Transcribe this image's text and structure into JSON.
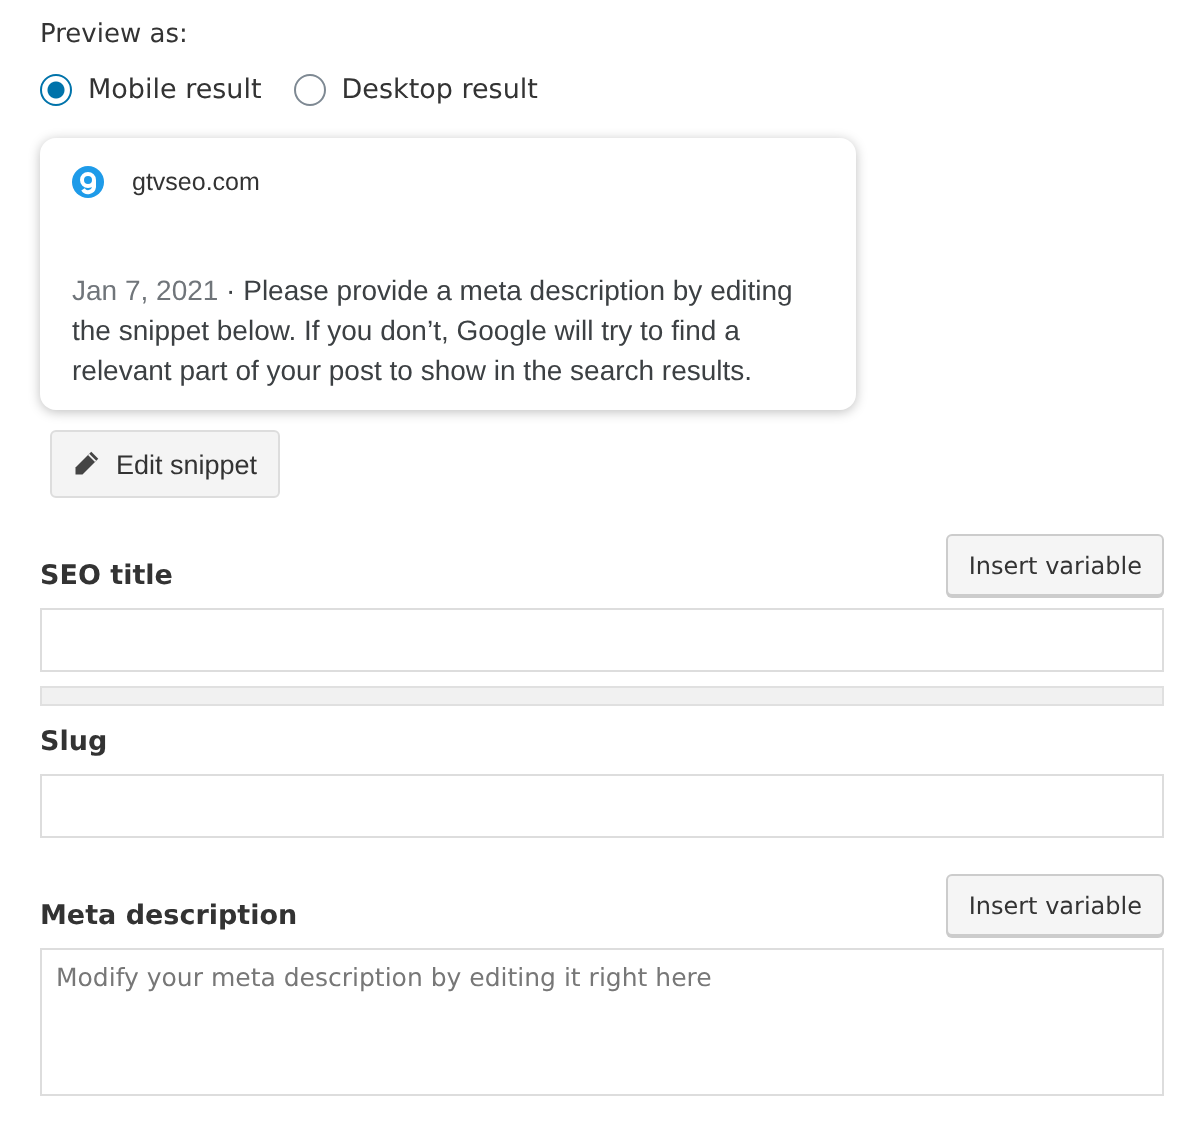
{
  "preview": {
    "label": "Preview as:",
    "options": [
      {
        "label": "Mobile result",
        "selected": true
      },
      {
        "label": "Desktop result",
        "selected": false
      }
    ]
  },
  "snippet": {
    "site": "gtvseo.com",
    "date": "Jan 7, 2021",
    "separator": " · ",
    "description": "Please provide a meta description by editing the snippet below. If you don’t, Google will try to find a relevant part of your post to show in the search results."
  },
  "edit_button": "Edit snippet",
  "fields": [
    {
      "kind": "input",
      "label": "SEO title",
      "button": "Insert variable",
      "progress": {
        "level": 0
      }
    },
    {
      "kind": "input",
      "label": "Slug"
    },
    {
      "kind": "textarea",
      "label": "Meta description",
      "button": "Insert variable",
      "placeholder": "Modify your meta description by editing it right here"
    }
  ]
}
